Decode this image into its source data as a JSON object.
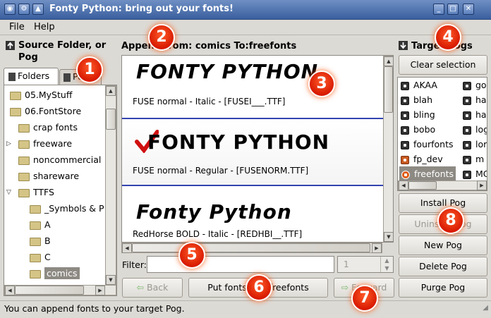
{
  "window": {
    "title": "Fonty Python: bring out your fonts!"
  },
  "menu": {
    "file": "File",
    "help": "Help"
  },
  "source": {
    "header": "Source Folder, or Pog",
    "tab_folders": "Folders",
    "tab_pogs": "Pogs",
    "tree": [
      "05.MyStuff",
      "06.FontStore",
      "crap fonts",
      "freeware",
      "noncommercial",
      "shareware",
      "TTFS",
      "_Symbols & P",
      "A",
      "B",
      "C",
      "comics"
    ]
  },
  "center": {
    "header": "Append from: comics To:freefonts",
    "fonts": [
      {
        "sample": "FONTY PYTHON",
        "info": "FUSE normal - Italic - [FUSEI___.TTF]"
      },
      {
        "sample": "FONTY PYTHON",
        "info": "FUSE normal - Regular - [FUSENORM.TTF]"
      },
      {
        "sample": "Fonty Python",
        "info": "RedHorse BOLD - Italic - [REDHBI__.TTF]"
      }
    ],
    "filter_label": "Filter:",
    "filter_value": "",
    "page_value": "1",
    "back_label": "Back",
    "put_label": "Put fonts into freefonts",
    "forward_label": "Forward"
  },
  "target": {
    "header": "Target Pogs",
    "clear_label": "Clear selection",
    "pogs_col1": [
      "AKAA",
      "blah",
      "bling",
      "bobo",
      "fourfonts",
      "fp_dev",
      "freefonts"
    ],
    "pogs_col2": [
      "go",
      "ha",
      "ha",
      "log",
      "lor",
      "m",
      "MC"
    ],
    "install_label": "Install Pog",
    "uninstall_label": "Uninstall Pog",
    "new_label": "New Pog",
    "delete_label": "Delete Pog",
    "purge_label": "Purge Pog"
  },
  "status": {
    "text": "You can append fonts to your target Pog."
  },
  "markers": [
    "1",
    "2",
    "3",
    "4",
    "5",
    "6",
    "7",
    "8"
  ],
  "colors": {
    "titlebar": "#3a5f9e",
    "selection": "#8d8a84",
    "divider": "#3344b0",
    "marker": "#e02000"
  }
}
